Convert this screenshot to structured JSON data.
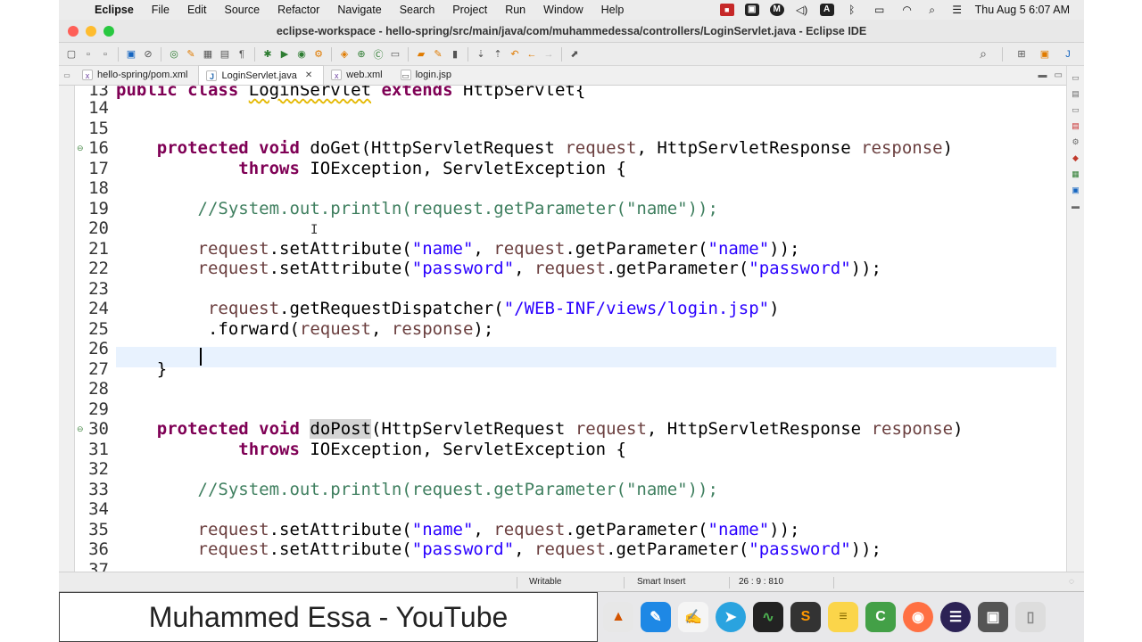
{
  "menubar": {
    "app_name": "Eclipse",
    "items": [
      "File",
      "Edit",
      "Source",
      "Refactor",
      "Navigate",
      "Search",
      "Project",
      "Run",
      "Window",
      "Help"
    ],
    "clock": "Thu Aug 5  6:07 AM",
    "status_icons": [
      "record-icon",
      "cast-icon",
      "m-icon",
      "volume-icon",
      "a-input-icon",
      "bluetooth-icon",
      "battery-icon",
      "wifi-icon",
      "search-icon",
      "control-center-icon"
    ]
  },
  "window": {
    "title": "eclipse-workspace - hello-spring/src/main/java/com/muhammedessa/controllers/LoginServlet.java - Eclipse IDE"
  },
  "tabs": [
    {
      "label": "hello-spring/pom.xml",
      "icon": "xml-file-icon",
      "active": false
    },
    {
      "label": "LoginServlet.java",
      "icon": "java-file-icon",
      "active": true
    },
    {
      "label": "web.xml",
      "icon": "xml-file-icon",
      "active": false
    },
    {
      "label": "login.jsp",
      "icon": "jsp-file-icon",
      "active": false
    }
  ],
  "tab_close": "✕",
  "editor": {
    "line_numbers": [
      "13",
      "14",
      "15",
      "16",
      "17",
      "18",
      "19",
      "20",
      "21",
      "22",
      "23",
      "24",
      "25",
      "26",
      "27",
      "28",
      "29",
      "30",
      "31",
      "32",
      "33",
      "34",
      "35",
      "36",
      "37"
    ],
    "current_line": "26"
  },
  "statusbar": {
    "mode": "Writable",
    "insert": "Smart Insert",
    "position": "26 : 9 : 810"
  },
  "watermark": "Muhammed Essa - YouTube",
  "dock_apps": [
    "matlab-icon",
    "xcode-icon",
    "script-editor-icon",
    "telegram-icon",
    "activity-monitor-icon",
    "sublime-text-icon",
    "notes-icon",
    "camtasia-icon",
    "firefox-icon",
    "eclipse-icon",
    "screenshot-icon",
    "trash-icon"
  ],
  "colors": {
    "keyword": "#7f0055",
    "string": "#2a00ff",
    "comment": "#3f7f5f",
    "parameter": "#6a3e3e",
    "current_line": "#e8f2fe"
  }
}
